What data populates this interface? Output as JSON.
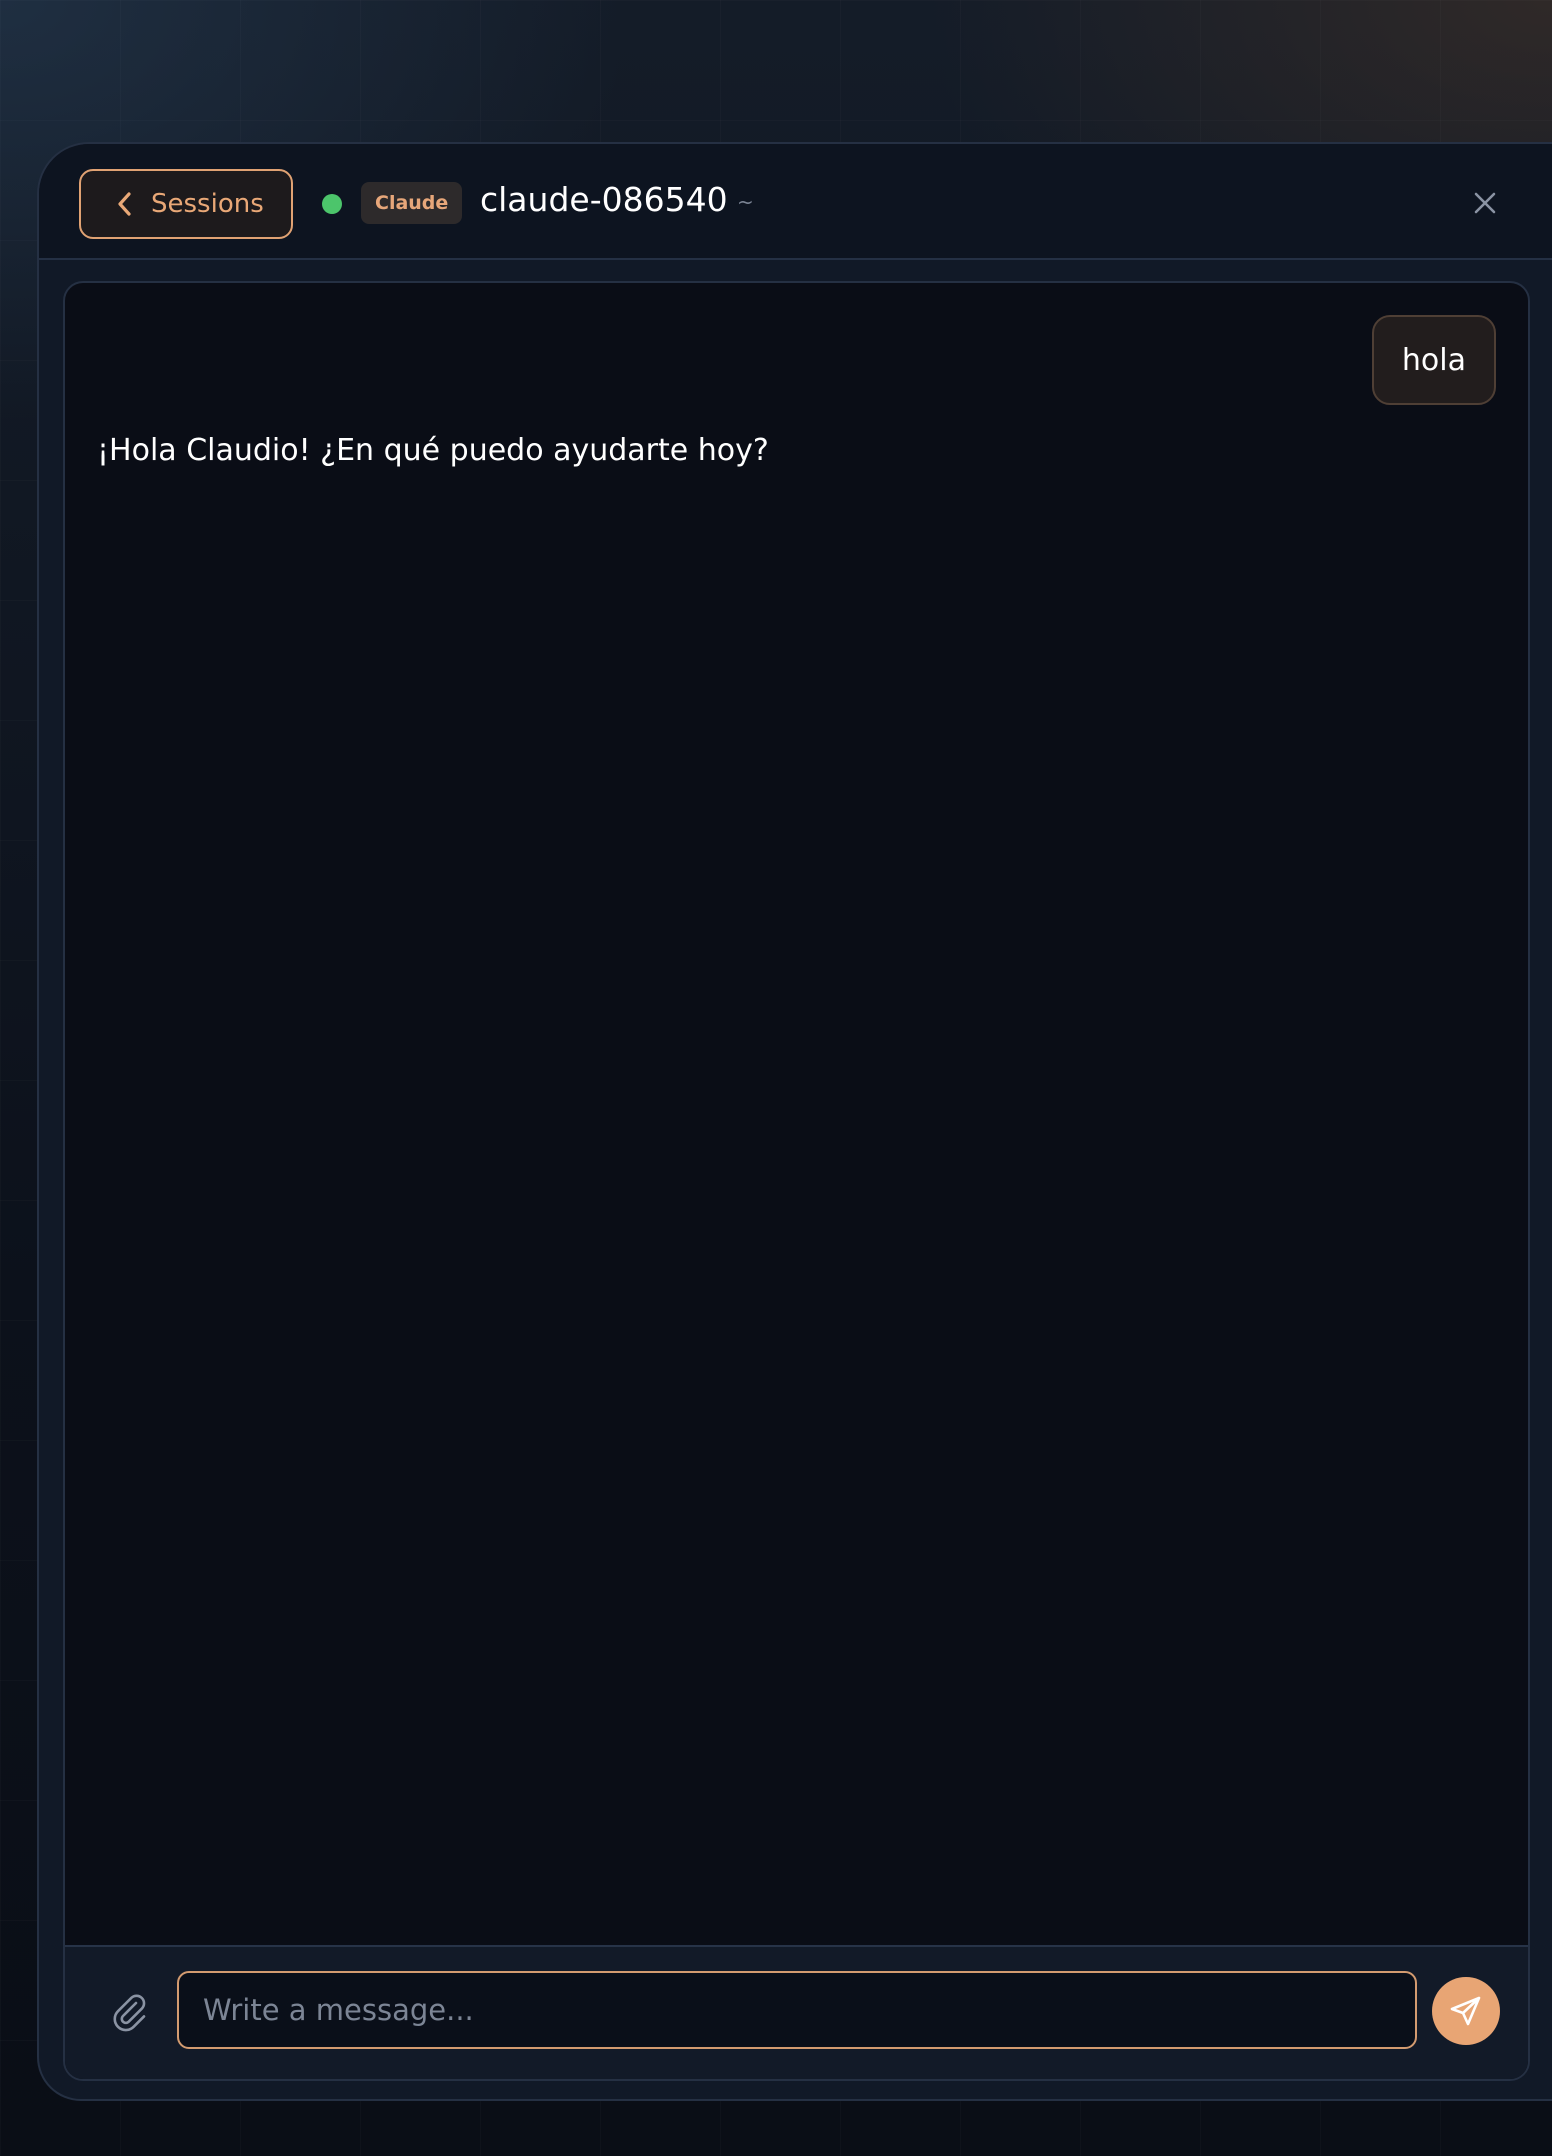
{
  "header": {
    "back_label": "Sessions",
    "back_icon": "chevron-left-icon",
    "status": "online",
    "status_color": "#4cc56b",
    "agent_badge": "Claude",
    "session_title": "claude-086540",
    "session_cwd": "~",
    "close_icon": "close-icon"
  },
  "messages": [
    {
      "role": "user",
      "text": "hola"
    },
    {
      "role": "assistant",
      "text": "¡Hola Claudio! ¿En qué puedo ayudarte hoy?"
    }
  ],
  "composer": {
    "attach_icon": "paperclip-icon",
    "placeholder": "Write a message...",
    "value": "",
    "send_icon": "send-icon"
  },
  "colors": {
    "accent": "#e8a574",
    "background": "#0a0d16",
    "status_online": "#4cc56b"
  }
}
